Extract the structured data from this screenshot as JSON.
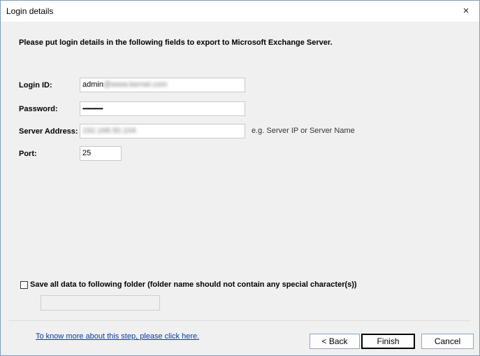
{
  "window": {
    "title": "Login details",
    "close_symbol": "×"
  },
  "instruction": "Please put login details in the following fields to export to Microsoft Exchange Server.",
  "fields": {
    "login_id": {
      "label": "Login ID:",
      "value_prefix": "admin",
      "value_masked": "@www.kernel.com"
    },
    "password": {
      "label": "Password:",
      "value": "••••••••••••••••"
    },
    "server_address": {
      "label": "Server Address:",
      "value_masked": "192.168.50.104",
      "hint": "e.g. Server IP or Server Name"
    },
    "port": {
      "label": "Port:",
      "value": "25"
    }
  },
  "save_option": {
    "checked": false,
    "label": "Save all data to following folder (folder name should not contain any special character(s))",
    "folder_value": ""
  },
  "help_link": "To know more about this step, please click here.",
  "buttons": {
    "back": "< Back",
    "finish": "Finish",
    "cancel": "Cancel"
  }
}
